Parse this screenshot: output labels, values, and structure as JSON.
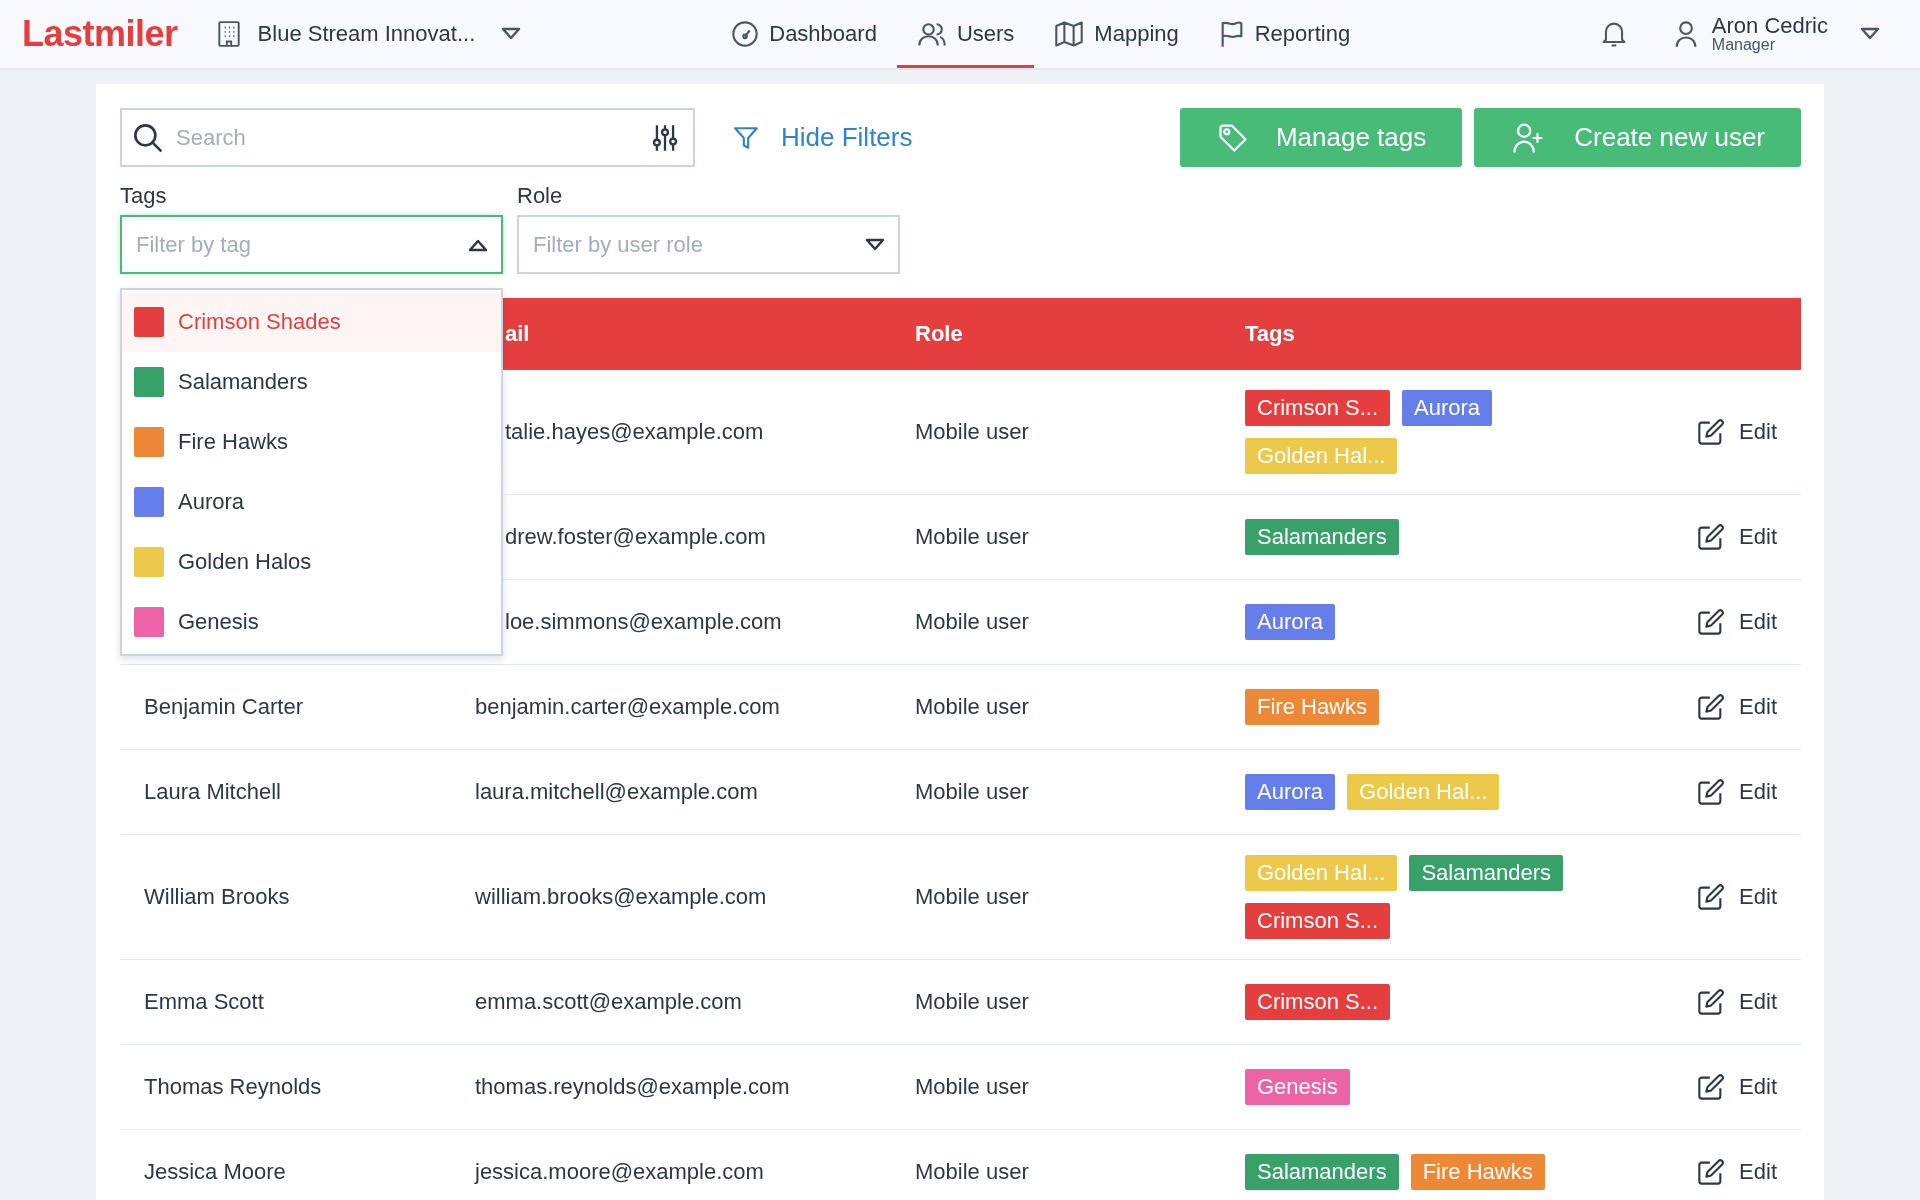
{
  "brand": "Lastmiler",
  "organization": "Blue Stream Innovat...",
  "nav": [
    {
      "label": "Dashboard",
      "kind": "gauge",
      "selected": false
    },
    {
      "label": "Users",
      "kind": "users",
      "selected": true
    },
    {
      "label": "Mapping",
      "kind": "map",
      "selected": false
    },
    {
      "label": "Reporting",
      "kind": "flag",
      "selected": false
    }
  ],
  "user": {
    "name": "Aron Cedric",
    "role": "Manager"
  },
  "search": {
    "placeholder": "Search"
  },
  "hide_filters": "Hide Filters",
  "buttons": [
    {
      "label": "Manage tags",
      "kind": "tag"
    },
    {
      "label": "Create new user",
      "kind": "user-plus"
    }
  ],
  "filters": [
    {
      "label": "Tags",
      "placeholder": "Filter by tag",
      "open": true
    },
    {
      "label": "Role",
      "placeholder": "Filter by user role",
      "open": false
    }
  ],
  "tag_options": [
    {
      "label": "Crimson Shades",
      "color": "#e53e3e",
      "selected": true
    },
    {
      "label": "Salamanders",
      "color": "#38a169",
      "selected": false
    },
    {
      "label": "Fire Hawks",
      "color": "#ed8936",
      "selected": false
    },
    {
      "label": "Aurora",
      "color": "#667eea",
      "selected": false
    },
    {
      "label": "Golden Halos",
      "color": "#ecc94b",
      "selected": false
    },
    {
      "label": "Genesis",
      "color": "#ed64a6",
      "selected": false
    }
  ],
  "table": {
    "columns": [
      "ail",
      "Role",
      "Tags"
    ],
    "rows": [
      {
        "email": "talie.hayes@example.com",
        "role": "Mobile user",
        "tags": [
          {
            "label": "Crimson S...",
            "color": "#e53e3e"
          },
          {
            "label": "Aurora",
            "color": "#667eea"
          },
          {
            "label": "Golden Hal...",
            "color": "#ecc94b"
          }
        ],
        "action": "Edit"
      },
      {
        "email": "drew.foster@example.com",
        "role": "Mobile user",
        "tags": [
          {
            "label": "Salamanders",
            "color": "#38a169"
          }
        ],
        "action": "Edit"
      },
      {
        "email": "loe.simmons@example.com",
        "role": "Mobile user",
        "tags": [
          {
            "label": "Aurora",
            "color": "#667eea"
          }
        ],
        "action": "Edit"
      },
      {
        "name": "Benjamin Carter",
        "email": "benjamin.carter@example.com",
        "role": "Mobile user",
        "tags": [
          {
            "label": "Fire Hawks",
            "color": "#ed8936"
          }
        ],
        "action": "Edit"
      },
      {
        "name": "Laura Mitchell",
        "email": "laura.mitchell@example.com",
        "role": "Mobile user",
        "tags": [
          {
            "label": "Aurora",
            "color": "#667eea"
          },
          {
            "label": "Golden Hal...",
            "color": "#ecc94b"
          }
        ],
        "action": "Edit"
      },
      {
        "name": "William Brooks",
        "email": "william.brooks@example.com",
        "role": "Mobile user",
        "tags": [
          {
            "label": "Golden Hal...",
            "color": "#ecc94b"
          },
          {
            "label": "Salamanders",
            "color": "#38a169"
          },
          {
            "label": "Crimson S...",
            "color": "#e53e3e"
          }
        ],
        "action": "Edit"
      },
      {
        "name": "Emma Scott",
        "email": "emma.scott@example.com",
        "role": "Mobile user",
        "tags": [
          {
            "label": "Crimson S...",
            "color": "#e53e3e"
          }
        ],
        "action": "Edit"
      },
      {
        "name": "Thomas Reynolds",
        "email": "thomas.reynolds@example.com",
        "role": "Mobile user",
        "tags": [
          {
            "label": "Genesis",
            "color": "#ed64a6"
          }
        ],
        "action": "Edit"
      },
      {
        "name": "Jessica Moore",
        "email": "jessica.moore@example.com",
        "role": "Mobile user",
        "tags": [
          {
            "label": "Salamanders",
            "color": "#38a169"
          },
          {
            "label": "Fire Hawks",
            "color": "#ed8936"
          }
        ],
        "action": "Edit"
      }
    ]
  }
}
